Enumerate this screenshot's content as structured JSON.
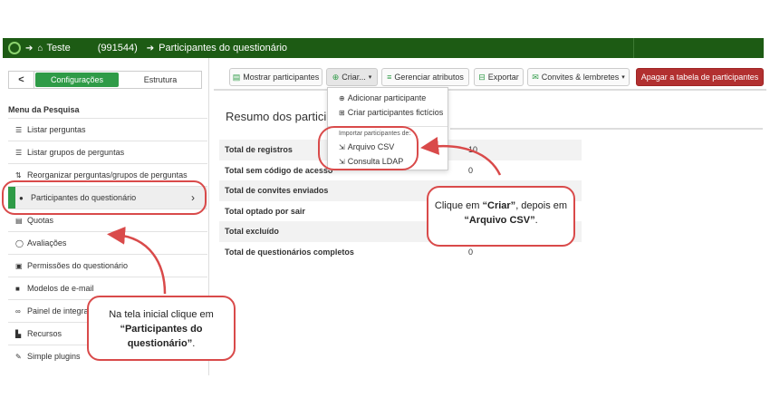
{
  "breadcrumb": {
    "home_label": "Teste",
    "survey_id": "(991544)",
    "page": "Participantes do questionário"
  },
  "sidebar": {
    "tabs": {
      "config": "Configurações",
      "structure": "Estrutura"
    },
    "menu_title": "Menu da Pesquisa",
    "items": [
      {
        "label": "Listar perguntas",
        "icon": "list-icon"
      },
      {
        "label": "Listar grupos de perguntas",
        "icon": "list-icon"
      },
      {
        "label": "Reorganizar perguntas/grupos de perguntas",
        "icon": "reorder-icon"
      },
      {
        "label": "Participantes do questionário",
        "icon": "user-icon"
      },
      {
        "label": "Quotas",
        "icon": "quota-icon"
      },
      {
        "label": "Avaliações",
        "icon": "comment-icon"
      },
      {
        "label": "Permissões do questionário",
        "icon": "lock-icon"
      },
      {
        "label": "Modelos de e-mail",
        "icon": "template-icon"
      },
      {
        "label": "Painel de integração",
        "icon": "link-icon"
      },
      {
        "label": "Recursos",
        "icon": "resources-icon"
      },
      {
        "label": "Simple plugins",
        "icon": "plugin-icon"
      }
    ]
  },
  "toolbar": {
    "show": "Mostrar participantes",
    "create": "Criar...",
    "manage": "Gerenciar atributos",
    "export": "Exportar",
    "invites": "Convites & lembretes",
    "delete": "Apagar a tabela de participantes"
  },
  "dropdown": {
    "add": "Adicionar participante",
    "fake": "Criar participantes fictícios",
    "import_header": "Importar participantes de:",
    "csv": "Arquivo CSV",
    "ldap": "Consulta LDAP"
  },
  "summary": {
    "title": "Resumo dos participantes",
    "rows": [
      {
        "label": "Total de registros",
        "value": "10"
      },
      {
        "label": "Total sem código de acesso",
        "value": "0"
      },
      {
        "label": "Total de convites enviados",
        "value": ""
      },
      {
        "label": "Total optado por sair",
        "value": ""
      },
      {
        "label": "Total excluído",
        "value": ""
      },
      {
        "label": "Total de questionários completos",
        "value": "0"
      }
    ]
  },
  "annotations": {
    "right": {
      "pre": "Clique em ",
      "b1": "“Criar”",
      "mid": ", depois em ",
      "b2": "“Arquivo CSV”",
      "post": "."
    },
    "left": {
      "pre": "Na tela inicial clique em ",
      "b1": "“Participantes do questionário”",
      "post": "."
    }
  },
  "colors": {
    "topbar": "#1d5b14",
    "accent": "#2f9b47",
    "danger": "#b23030",
    "annotation": "#d94a4a"
  }
}
